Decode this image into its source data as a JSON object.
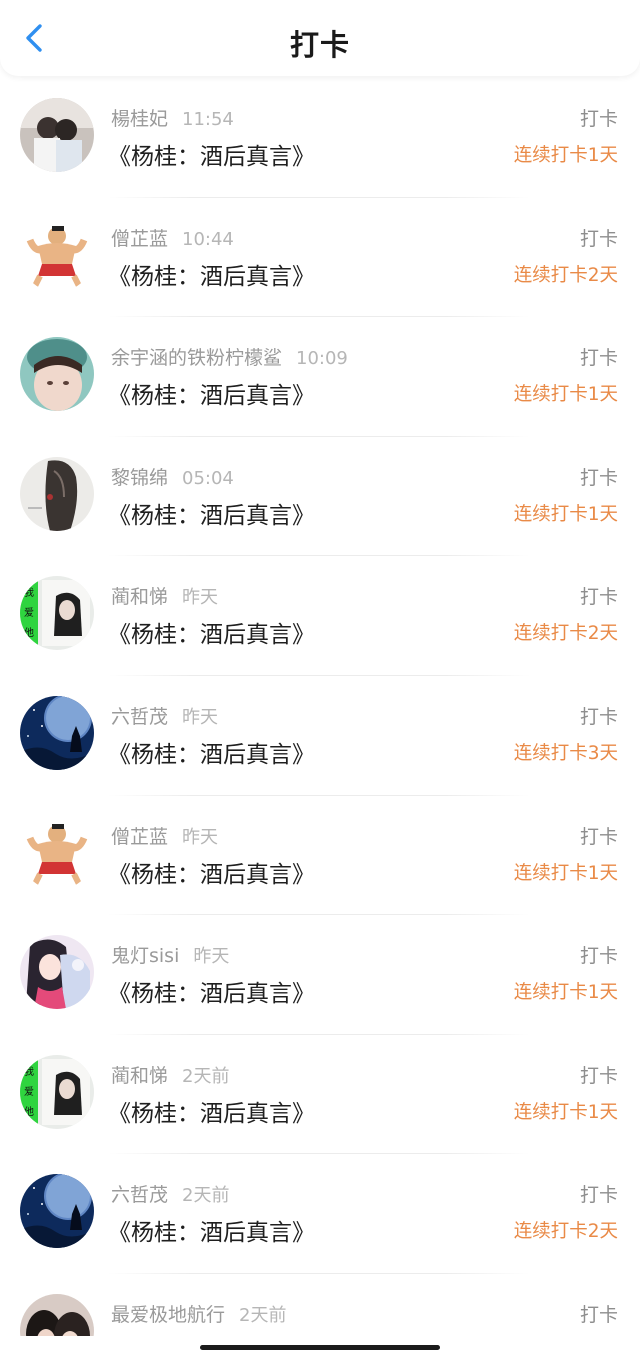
{
  "header": {
    "title": "打卡",
    "back_icon": "chevron-left-icon",
    "accent": "#2f8ff0"
  },
  "colors": {
    "streak": "#e98a47",
    "name": "#9a9a9a",
    "time": "#b6b6b6"
  },
  "items": [
    {
      "name": "楊桂妃",
      "time": "11:54",
      "title": "《杨桂：酒后真言》",
      "action": "打卡",
      "streak": "连续打卡1天",
      "avatar": "couple-photo"
    },
    {
      "name": "僧芷蓝",
      "time": "10:44",
      "title": "《杨桂：酒后真言》",
      "action": "打卡",
      "streak": "连续打卡2天",
      "avatar": "muscle-man-cartoon"
    },
    {
      "name": "余宇涵的铁粉柠檬鲨",
      "time": "10:09",
      "title": "《杨桂：酒后真言》",
      "action": "打卡",
      "streak": "连续打卡1天",
      "avatar": "boy-portrait"
    },
    {
      "name": "黎锦绵",
      "time": "05:04",
      "title": "《杨桂：酒后真言》",
      "action": "打卡",
      "streak": "连续打卡1天",
      "avatar": "long-hair-drawing"
    },
    {
      "name": "蔺和悌",
      "time": "昨天",
      "title": "《杨桂：酒后真言》",
      "action": "打卡",
      "streak": "连续打卡2天",
      "avatar": "green-girl-photo"
    },
    {
      "name": "六哲茂",
      "time": "昨天",
      "title": "《杨桂：酒后真言》",
      "action": "打卡",
      "streak": "连续打卡3天",
      "avatar": "blue-moon-scene"
    },
    {
      "name": "僧芷蓝",
      "time": "昨天",
      "title": "《杨桂：酒后真言》",
      "action": "打卡",
      "streak": "连续打卡1天",
      "avatar": "muscle-man-cartoon"
    },
    {
      "name": "鬼灯sisi",
      "time": "昨天",
      "title": "《杨桂：酒后真言》",
      "action": "打卡",
      "streak": "连续打卡1天",
      "avatar": "anime-girl"
    },
    {
      "name": "蔺和悌",
      "time": "2天前",
      "title": "《杨桂：酒后真言》",
      "action": "打卡",
      "streak": "连续打卡1天",
      "avatar": "green-girl-photo"
    },
    {
      "name": "六哲茂",
      "time": "2天前",
      "title": "《杨桂：酒后真言》",
      "action": "打卡",
      "streak": "连续打卡2天",
      "avatar": "blue-moon-scene"
    },
    {
      "name": "最爱极地航行",
      "time": "2天前",
      "title": "",
      "action": "打卡",
      "streak": "",
      "avatar": "two-people-photo"
    }
  ]
}
